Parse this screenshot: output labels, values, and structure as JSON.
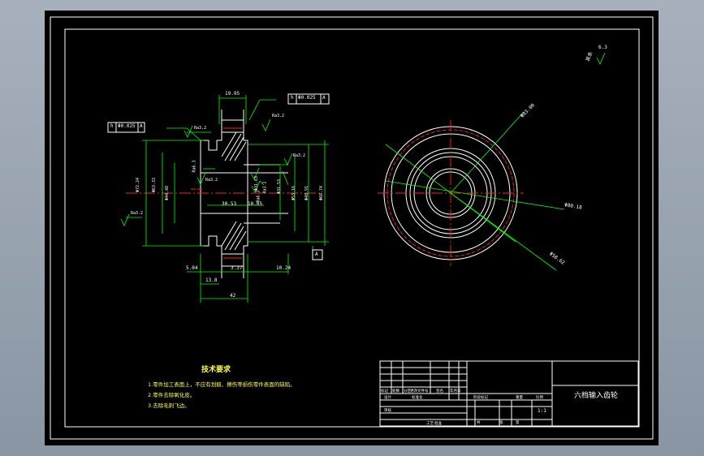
{
  "drawing": {
    "dims": {
      "top_width": "19.95",
      "left_tol_h": "h",
      "left_tol_val": "Φ0.025",
      "left_tol_a": "A",
      "top_tol_h": "h",
      "top_tol_val": "Φ0.025",
      "top_tol_a": "A",
      "rough_1": "Ra3.2",
      "rough_2": "Ra3.2",
      "rough_3": "Ra3.2",
      "rough_4": "Ra6.3",
      "rough_5": "Ra3.2",
      "rough_6": "Ra3.2",
      "rough_7": "Ra6.3",
      "rough_8": "Ra3.2",
      "d_left_outer": "Φ72.24",
      "d_left_2": "Φ63.33",
      "d_left_3": "Φ44.48",
      "d_inner_1": "Φ31.53",
      "d_inner_2": "Φ31.63",
      "d_right_1": "Φ53.16",
      "d_right_2": "Φ48.91",
      "d_right_3": "Φ68.74",
      "mid_1": "30.53",
      "mid_2": "10.05",
      "bot_1": "5.04",
      "bot_2": "3.37",
      "bot_3": "10.24",
      "bot_4": "13.8",
      "bot_overall": "42",
      "datum": "A"
    },
    "circle_labels": {
      "c1": "Φ83.00",
      "c2": "Φ80.18",
      "c3": "Φ58.62"
    },
    "corner_rough": {
      "label": "其余",
      "val": "6.3"
    }
  },
  "notes": {
    "title": "技术要求",
    "lines": [
      "1.零件加工表面上，不应有划痕、擦伤等损伤零件表面的缺陷。",
      "2.零件去除氧化皮。",
      "3.去除毛刺飞边。"
    ]
  },
  "title_block": {
    "part_name": "六档输入齿轮",
    "scale": "1:1",
    "cells": {
      "mark": "标记",
      "count": "处数",
      "zone": "分区",
      "change_doc": "更改文件号",
      "sign": "签名",
      "date": "年月日",
      "design": "设计",
      "standard": "标准化",
      "stage_mark": "阶段标记",
      "weight": "重量",
      "ratio": "比例",
      "review": "审核",
      "process": "工艺",
      "approve": "批准",
      "sheet_total": "共",
      "sheet": "张",
      "sheet_no": "第"
    }
  }
}
